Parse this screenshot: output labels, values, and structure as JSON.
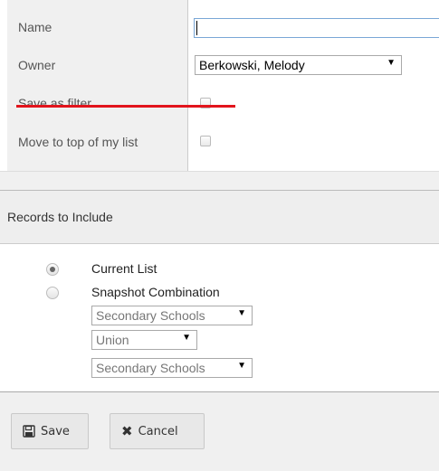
{
  "form": {
    "name_label": "Name",
    "name_value": "",
    "owner_label": "Owner",
    "owner_value": "Berkowski, Melody",
    "save_filter_label": "Save as filter",
    "move_top_label": "Move to top of my list"
  },
  "records": {
    "title": "Records to Include",
    "current_list_label": "Current List",
    "snapshot_label": "Snapshot Combination",
    "snapshot_1": "Secondary Schools",
    "operator": "Union",
    "snapshot_2": "Secondary Schools"
  },
  "actions": {
    "save_label": "Save",
    "cancel_label": "Cancel"
  },
  "colors": {
    "strike": "#e2141c"
  }
}
